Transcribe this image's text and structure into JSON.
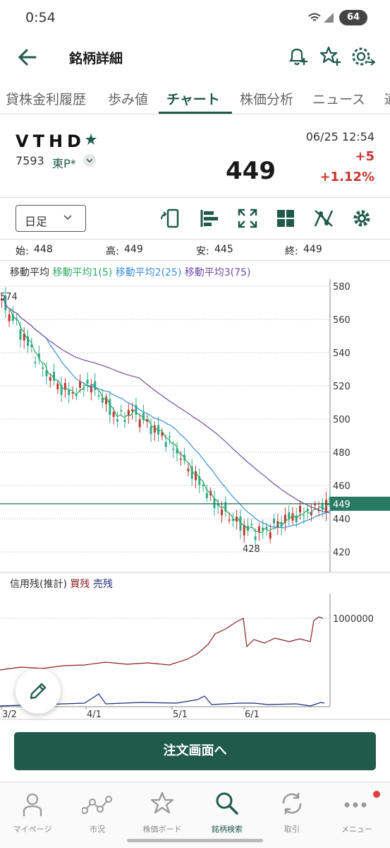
{
  "status_bar": {
    "time": "0:54",
    "battery": "64"
  },
  "header": {
    "title": "銘柄詳細"
  },
  "tabs": [
    {
      "label": "貸株金利履歴"
    },
    {
      "label": "歩み値"
    },
    {
      "label": "チャート",
      "active": true
    },
    {
      "label": "株価分析"
    },
    {
      "label": "ニュース"
    },
    {
      "label": "適"
    }
  ],
  "stock": {
    "ticker": "VTHD",
    "code": "7593",
    "market": "東P*",
    "price": "449",
    "datetime": "06/25 12:54",
    "change": "+5",
    "change_percent": "+1.12%"
  },
  "toolbar": {
    "period": "日足"
  },
  "ohlc": {
    "open_label": "始:",
    "open": "448",
    "high_label": "高:",
    "high": "449",
    "low_label": "安:",
    "low": "445",
    "close_label": "終:",
    "close": "449"
  },
  "ma_legend": {
    "title": "移動平均",
    "ma1": "移動平均1(5)",
    "ma2": "移動平均2(25)",
    "ma3": "移動平均3(75)"
  },
  "credit_legend": {
    "title": "信用残(推計)",
    "buy": "買残",
    "sell": "売残"
  },
  "chart_data": [
    {
      "type": "candlestick",
      "y_ticks": [
        "580",
        "560",
        "540",
        "520",
        "500",
        "480",
        "460",
        "440",
        "420"
      ],
      "ylim": [
        415,
        585
      ],
      "max_label": "574",
      "min_label": "428",
      "last_price_label": "449",
      "series": [
        {
          "name": "移動平均1(5)",
          "color": "#2eaa62"
        },
        {
          "name": "移動平均2(25)",
          "color": "#3a8fd8"
        },
        {
          "name": "移動平均3(75)",
          "color": "#6d4ea3"
        }
      ]
    },
    {
      "type": "line",
      "y_ticks": [
        "1000000"
      ],
      "x_ticks": [
        "3/2",
        "4/1",
        "5/1",
        "6/1"
      ],
      "series": [
        {
          "name": "買残",
          "color": "#8b1e1e"
        },
        {
          "name": "売残",
          "color": "#1d2b7a"
        }
      ]
    }
  ],
  "order_button": {
    "label": "注文画面へ"
  },
  "bottom_nav": [
    {
      "label": "マイページ",
      "icon": "person-icon"
    },
    {
      "label": "市況",
      "icon": "market-icon"
    },
    {
      "label": "株価ボード",
      "icon": "star-icon"
    },
    {
      "label": "銘柄検索",
      "icon": "search-icon",
      "active": true
    },
    {
      "label": "取引",
      "icon": "trade-icon"
    },
    {
      "label": "メニュー",
      "icon": "menu-icon"
    }
  ],
  "colors": {
    "brand": "#1f5a4a",
    "up": "#c8342f",
    "down": "#2eaa8a"
  }
}
